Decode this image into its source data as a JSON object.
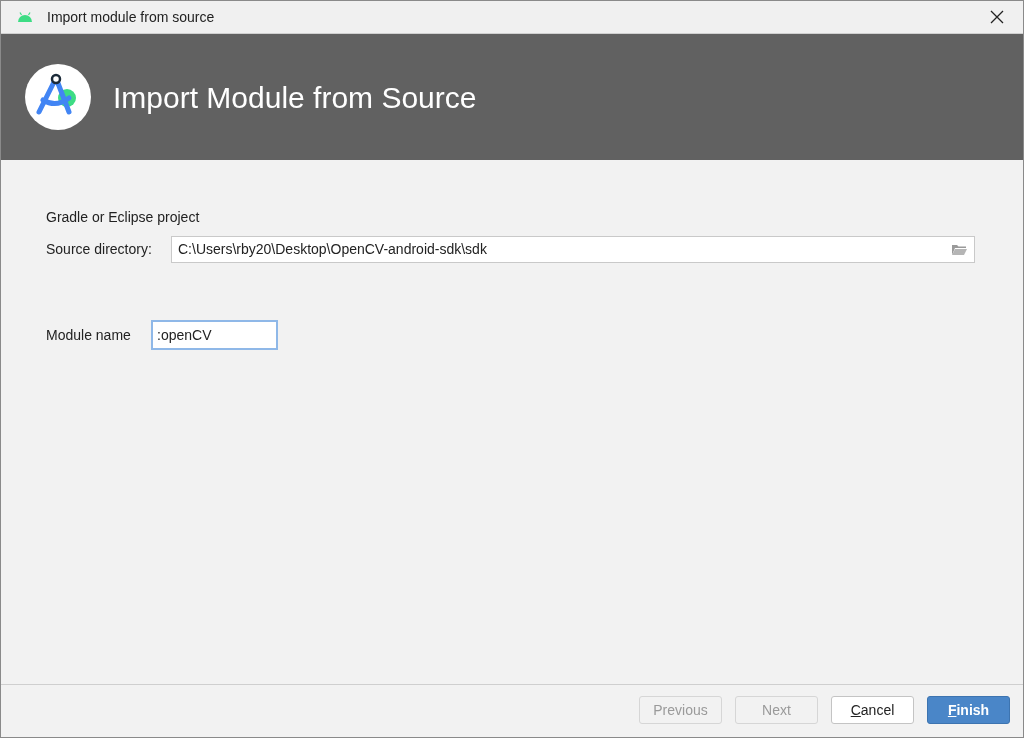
{
  "window": {
    "title": "Import module from source"
  },
  "header": {
    "title": "Import Module from Source"
  },
  "section_label": "Gradle or Eclipse project",
  "source_directory": {
    "label": "Source directory:",
    "value": "C:\\Users\\rby20\\Desktop\\OpenCV-android-sdk\\sdk"
  },
  "module_name": {
    "label": "Module name",
    "value": ":openCV",
    "focused": true
  },
  "buttons": [
    {
      "label": "Previous",
      "kind": "default",
      "disabled": true,
      "mnemonic_first": false
    },
    {
      "label": "Next",
      "kind": "default",
      "disabled": true,
      "mnemonic_first": false
    },
    {
      "label": "Cancel",
      "kind": "default",
      "disabled": false,
      "mnemonic_first": true
    },
    {
      "label": "Finish",
      "kind": "primary",
      "disabled": false,
      "mnemonic_first": true
    }
  ]
}
